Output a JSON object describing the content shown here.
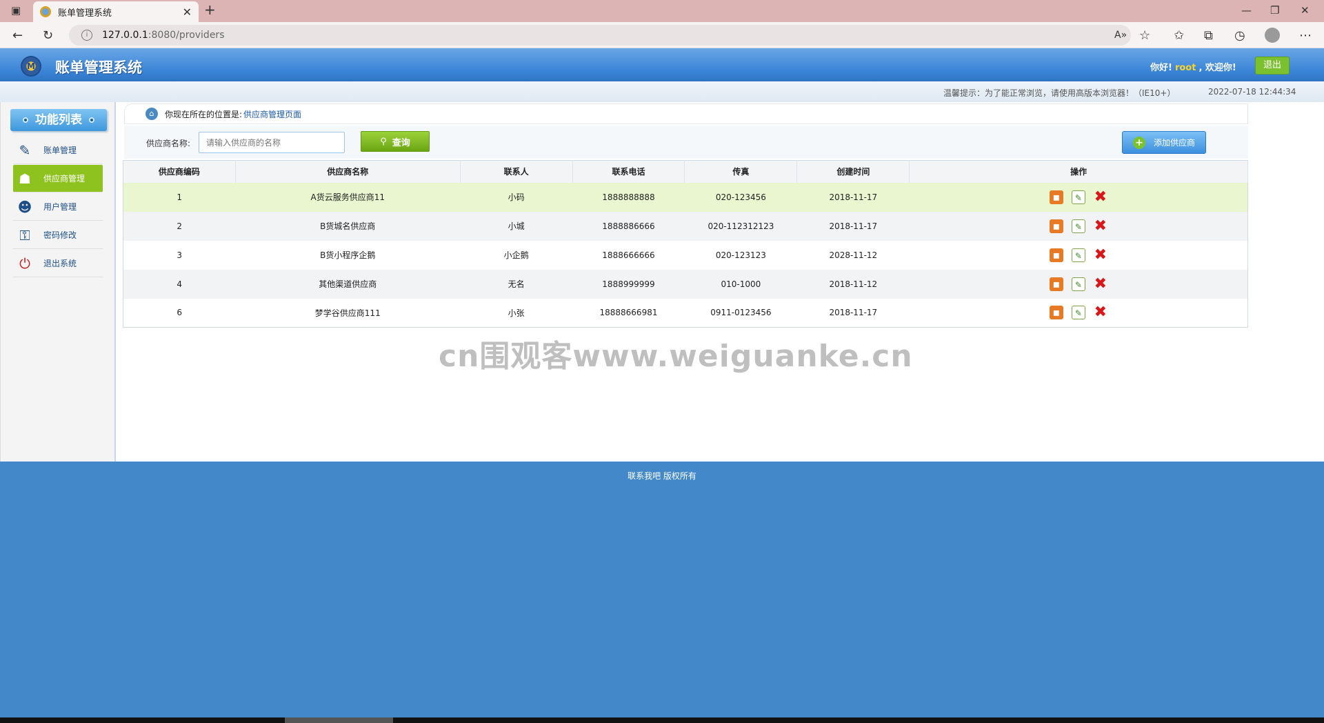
{
  "browser": {
    "tab_title": "账单管理系统",
    "url_host": "127.0.0.1",
    "url_rest": ":8080/providers"
  },
  "header": {
    "app_title": "账单管理系统",
    "greeting_prefix": "你好!",
    "username": "root",
    "greeting_suffix": ", 欢迎你!",
    "logout_label": "退出"
  },
  "tipbar": {
    "tip": "温馨提示：为了能正常浏览，请使用高版本浏览器！（IE10+）",
    "datetime": "2022-07-18 12:44:34"
  },
  "sidebar": {
    "title": "功能列表",
    "items": [
      {
        "label": "账单管理",
        "icon": "bill-icon"
      },
      {
        "label": "供应商管理",
        "icon": "provider-icon"
      },
      {
        "label": "用户管理",
        "icon": "users-icon"
      },
      {
        "label": "密码修改",
        "icon": "password-icon"
      },
      {
        "label": "退出系统",
        "icon": "exit-icon"
      }
    ]
  },
  "breadcrumb": {
    "prefix": "你现在所在的位置是:",
    "current": "供应商管理页面"
  },
  "search": {
    "label": "供应商名称:",
    "placeholder": "请输入供应商的名称",
    "button_label": "查询",
    "add_label": "添加供应商"
  },
  "table": {
    "headers": [
      "供应商编码",
      "供应商名称",
      "联系人",
      "联系电话",
      "传真",
      "创建时间",
      "操作"
    ],
    "rows": [
      [
        "1",
        "A货云服务供应商11",
        "小码",
        "1888888888",
        "020-123456",
        "2018-11-17"
      ],
      [
        "2",
        "B货城名供应商",
        "小城",
        "1888886666",
        "020-112312123",
        "2018-11-17"
      ],
      [
        "3",
        "B货小程序企鹅",
        "小企鹅",
        "1888666666",
        "020-123123",
        "2028-11-12"
      ],
      [
        "4",
        "其他渠道供应商",
        "无名",
        "1888999999",
        "010-1000",
        "2018-11-12"
      ],
      [
        "6",
        "梦学谷供应商111",
        "小张",
        "18888666981",
        "0911-0123456",
        "2018-11-17"
      ]
    ]
  },
  "watermark": "cn围观客www.weiguanke.cn",
  "footer": {
    "text": "联系我吧 版权所有"
  }
}
